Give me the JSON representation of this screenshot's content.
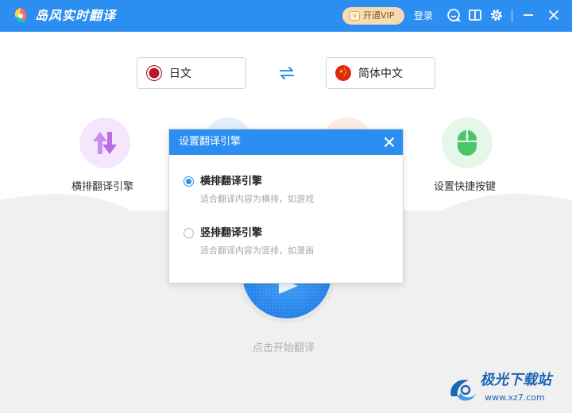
{
  "app": {
    "title": "岛风实时翻译",
    "vip_label": "开通VIP",
    "login_label": "登录",
    "colors": {
      "primary": "#2b8ef0",
      "vip_bg": "#f4dbb0",
      "background": "#f0f0f0"
    }
  },
  "toolbar_icons": [
    "chat-icon",
    "book-icon",
    "settings-icon",
    "minimize-icon",
    "close-icon"
  ],
  "languages": {
    "source": "日文",
    "target": "简体中文",
    "source_flag": "japan-flag",
    "target_flag": "china-flag",
    "swap_icon": "swap-arrows-icon"
  },
  "features": [
    {
      "label": "横排翻译引擎",
      "icon": "sort-arrows-icon",
      "color": "#c88ff0"
    },
    {
      "label": "",
      "icon": "hidden-feature-icon",
      "color": "#bcd6f5"
    },
    {
      "label": "",
      "icon": "hidden-feature-icon",
      "color": "#f8d8c8"
    },
    {
      "label": "设置快捷按键",
      "icon": "mouse-icon",
      "color": "#4cc56a"
    }
  ],
  "start": {
    "label": "点击开始翻译"
  },
  "dialog": {
    "title": "设置翻译引擎",
    "options": [
      {
        "title": "横排翻译引擎",
        "desc": "适合翻译内容为横排，如游戏",
        "selected": true
      },
      {
        "title": "竖排翻译引擎",
        "desc": "适合翻译内容为竖排，如漫画",
        "selected": false
      }
    ]
  },
  "watermark": {
    "line1": "极光下载站",
    "line2": "www.xz7.com"
  }
}
